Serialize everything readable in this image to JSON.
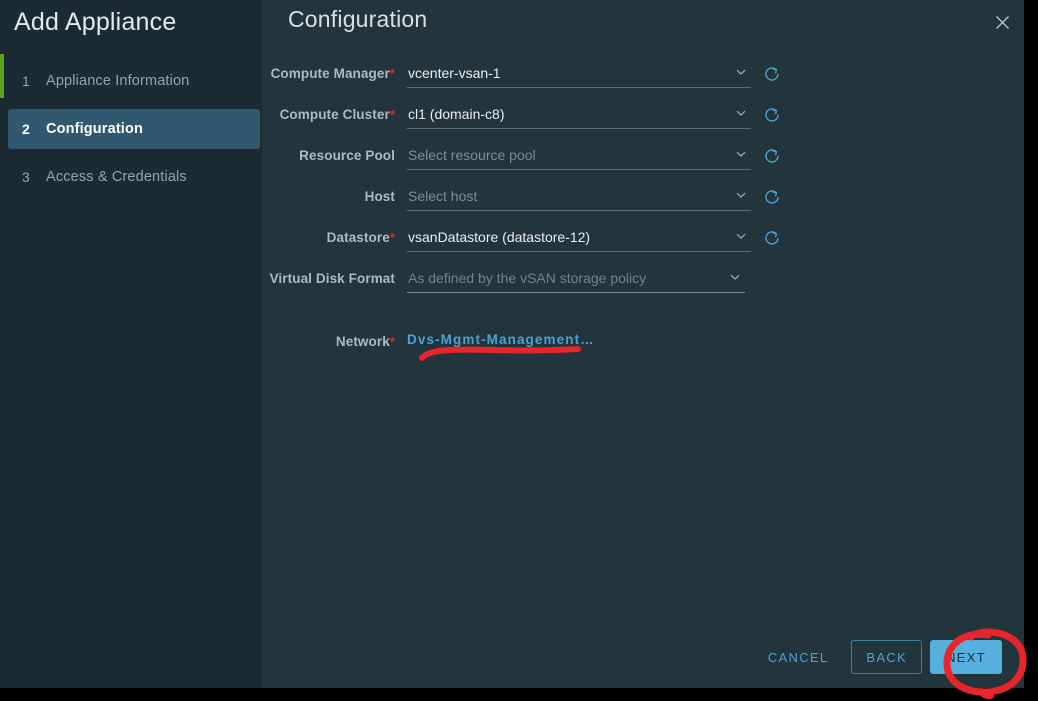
{
  "window": {
    "wizard_title": "Add Appliance",
    "header_title": "Configuration",
    "close_icon": "close-icon"
  },
  "sidebar": {
    "steps": [
      {
        "num": "1",
        "label": "Appliance Information",
        "state": "completed"
      },
      {
        "num": "2",
        "label": "Configuration",
        "state": "active"
      },
      {
        "num": "3",
        "label": "Access & Credentials",
        "state": "pending"
      }
    ]
  },
  "form": {
    "required_marker": "*",
    "fields": [
      {
        "label": "Compute Manager",
        "required": true,
        "value": "vcenter-vsan-1",
        "is_placeholder": false,
        "disabled": false,
        "has_refresh": true
      },
      {
        "label": "Compute Cluster",
        "required": true,
        "value": "cl1 (domain-c8)",
        "is_placeholder": false,
        "disabled": false,
        "has_refresh": true
      },
      {
        "label": "Resource Pool",
        "required": false,
        "value": "Select resource pool",
        "is_placeholder": true,
        "disabled": false,
        "has_refresh": true
      },
      {
        "label": "Host",
        "required": false,
        "value": "Select host",
        "is_placeholder": true,
        "disabled": false,
        "has_refresh": true
      },
      {
        "label": "Datastore",
        "required": true,
        "value": "vsanDatastore (datastore-12)",
        "is_placeholder": false,
        "disabled": false,
        "has_refresh": true
      },
      {
        "label": "Virtual Disk Format",
        "required": false,
        "value": "As defined by the vSAN storage policy",
        "is_placeholder": false,
        "disabled": true,
        "has_refresh": false
      }
    ],
    "network": {
      "label": "Network",
      "required": true,
      "link_text": "Dvs-Mgmt-Management…"
    }
  },
  "footer": {
    "cancel_label": "CANCEL",
    "back_label": "BACK",
    "next_label": "NEXT"
  },
  "colors": {
    "panel_bg": "#22343c",
    "sidebar_bg": "#1b2b34",
    "active_step_bg": "#31586f",
    "completed_accent": "#62a420",
    "link_blue": "#4ba3d4",
    "primary_button_bg": "#56b0dd",
    "required_red": "#e02b20",
    "annotation_red": "#e8252a"
  },
  "annotations": [
    {
      "name": "network-underline",
      "type": "underline",
      "color": "#e8252a"
    },
    {
      "name": "next-button-circle",
      "type": "ellipse",
      "color": "#e8252a"
    }
  ]
}
